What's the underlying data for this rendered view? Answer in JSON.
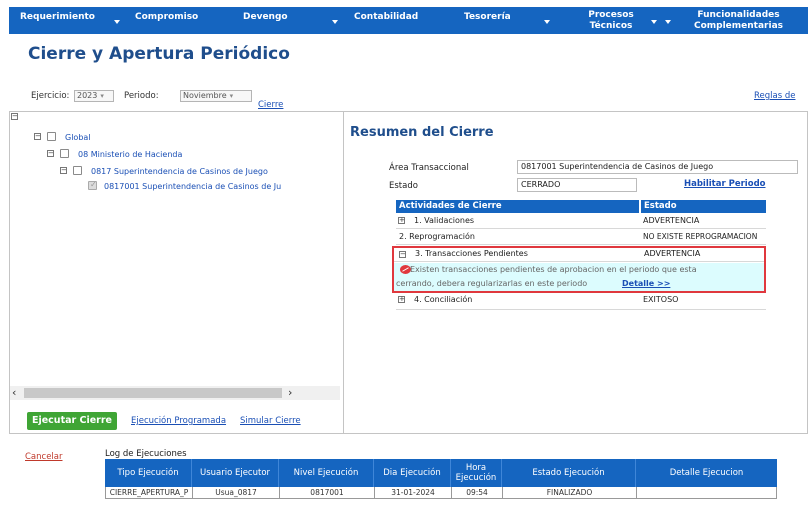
{
  "nav": {
    "items": [
      {
        "label": "Requerimiento",
        "caret": true
      },
      {
        "label": "Compromiso",
        "caret": false
      },
      {
        "label": "Devengo",
        "caret": true
      },
      {
        "label": "Contabilidad",
        "caret": false
      },
      {
        "label": "Tesorería",
        "caret": true
      },
      {
        "label": "Procesos\nTécnicos",
        "caret": true
      },
      {
        "label": "Funcionalidades\nComplementarias",
        "caret": true
      }
    ]
  },
  "page_title": "Cierre y Apertura Periódico",
  "filters": {
    "ejercicio_label": "Ejercicio:",
    "ejercicio_value": "2023",
    "periodo_label": "Periodo:",
    "periodo_value": "Noviembre",
    "cierre_link": "Cierre",
    "reglas_link": "Reglas de"
  },
  "tree": {
    "nodes": [
      {
        "label": "Global",
        "expander": "⊟",
        "checked": false
      },
      {
        "label": "08 Ministerio de Hacienda",
        "expander": "⊟",
        "checked": false
      },
      {
        "label": "0817 Superintendencia de Casinos de Juego",
        "expander": "⊟",
        "checked": false
      },
      {
        "label": "0817001 Superintendencia de Casinos de Ju",
        "expander": "",
        "checked": true
      }
    ]
  },
  "actions": {
    "ejecutar": "Ejecutar Cierre",
    "programada": "Ejecución Programada",
    "simular": "Simular Cierre"
  },
  "summary": {
    "title": "Resumen del Cierre",
    "area_label": "Área Transaccional",
    "area_value": "0817001 Superintendencia de Casinos de Juego",
    "estado_label": "Estado",
    "estado_value": "CERRADO",
    "habilitar_link": "Habilitar Periodo",
    "table_headers": [
      "Actividades de Cierre",
      "Estado"
    ],
    "rows": [
      {
        "expander": "⊞",
        "activity": "1. Validaciones",
        "status": "ADVERTENCIA"
      },
      {
        "expander": "",
        "activity": "2. Reprogramación",
        "status": "NO EXISTE REPROGRAMACION"
      },
      {
        "expander": "⊟",
        "activity": "3. Transacciones Pendientes",
        "status": "ADVERTENCIA"
      },
      {
        "expander": "⊞",
        "activity": "4. Conciliación",
        "status": "EXITOSO"
      }
    ],
    "pending_message_line1": "Existen transacciones pendientes de aprobacion en el periodo que esta",
    "pending_message_line2": "cerrando, debera regularizarlas en este periodo",
    "detalle_link": "Detalle >>"
  },
  "log": {
    "cancelar": "Cancelar",
    "title": "Log de Ejecuciones",
    "headers": [
      "Tipo Ejecución",
      "Usuario Ejecutor",
      "Nivel Ejecución",
      "Dia Ejecución",
      "Hora\nEjecución",
      "Estado Ejecución",
      "Detalle Ejecucion"
    ],
    "rows": [
      [
        "CIERRE_APERTURA_P",
        "Usua_0817",
        "0817001",
        "31-01-2024",
        "09:54",
        "FINALIZADO",
        ""
      ]
    ]
  },
  "colors": {
    "nav_blue": "#1565c0",
    "title_blue": "#1f4e8c",
    "button_green": "#3fa535",
    "highlight_red": "#e0383e",
    "message_cyan": "#dcfcfe"
  }
}
